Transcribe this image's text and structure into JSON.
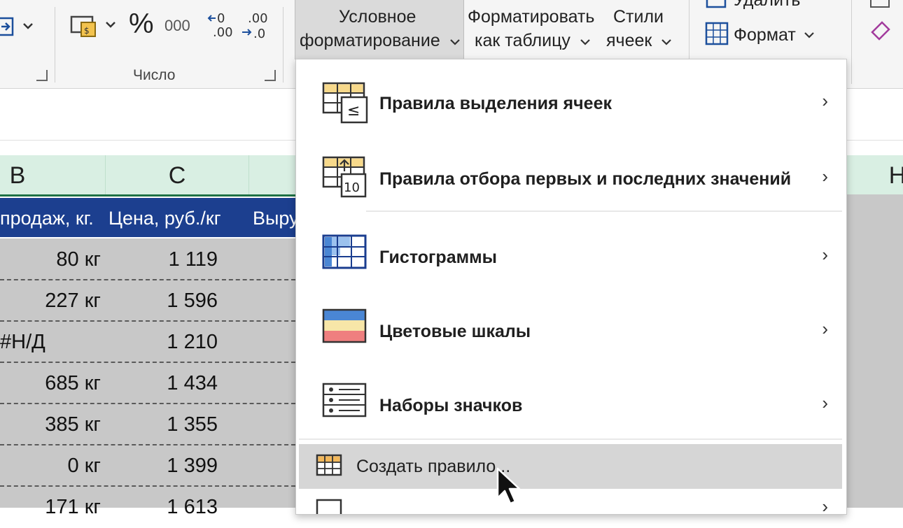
{
  "ribbon": {
    "percent": "%",
    "thousands": "000",
    "dec_increase": "←0 .00",
    "dec_decrease": ".00 →0",
    "number_group": "Число",
    "cond_format_line1": "Условное",
    "cond_format_line2": "форматирование",
    "format_table_line1": "Форматировать",
    "format_table_line2": "как таблицу",
    "cell_styles_line1": "Стили",
    "cell_styles_line2": "ячеек",
    "delete": "Удалить",
    "format": "Формат"
  },
  "columns": [
    "B",
    "C",
    "H"
  ],
  "table_header": [
    "продаж, кг.",
    "Цена, руб./кг",
    "Выру"
  ],
  "rows": [
    {
      "qty": "80 кг",
      "price": "1 119"
    },
    {
      "qty": "227 кг",
      "price": "1 596"
    },
    {
      "qty": "#Н/Д",
      "price": "1 210"
    },
    {
      "qty": "685 кг",
      "price": "1 434"
    },
    {
      "qty": "385 кг",
      "price": "1 355"
    },
    {
      "qty": "0 кг",
      "price": "1 399"
    },
    {
      "qty": "171 кг",
      "price": "1 613"
    }
  ],
  "menu": {
    "items": [
      {
        "label": "Правила выделения ячеек",
        "icon": "highlight-rules-icon"
      },
      {
        "label": "Правила отбора первых и последних значений",
        "icon": "top-bottom-rules-icon"
      },
      {
        "label": "Гистограммы",
        "icon": "data-bars-icon"
      },
      {
        "label": "Цветовые шкалы",
        "icon": "color-scales-icon"
      },
      {
        "label": "Наборы значков",
        "icon": "icon-sets-icon"
      }
    ],
    "new_rule": "Создать правило...",
    "arrow": "›"
  },
  "colors": {
    "header_blue": "#1c3f8f",
    "excel_green": "#1e7145",
    "col_header_bg": "#d9efe3",
    "hover": "#d6d6d6"
  }
}
